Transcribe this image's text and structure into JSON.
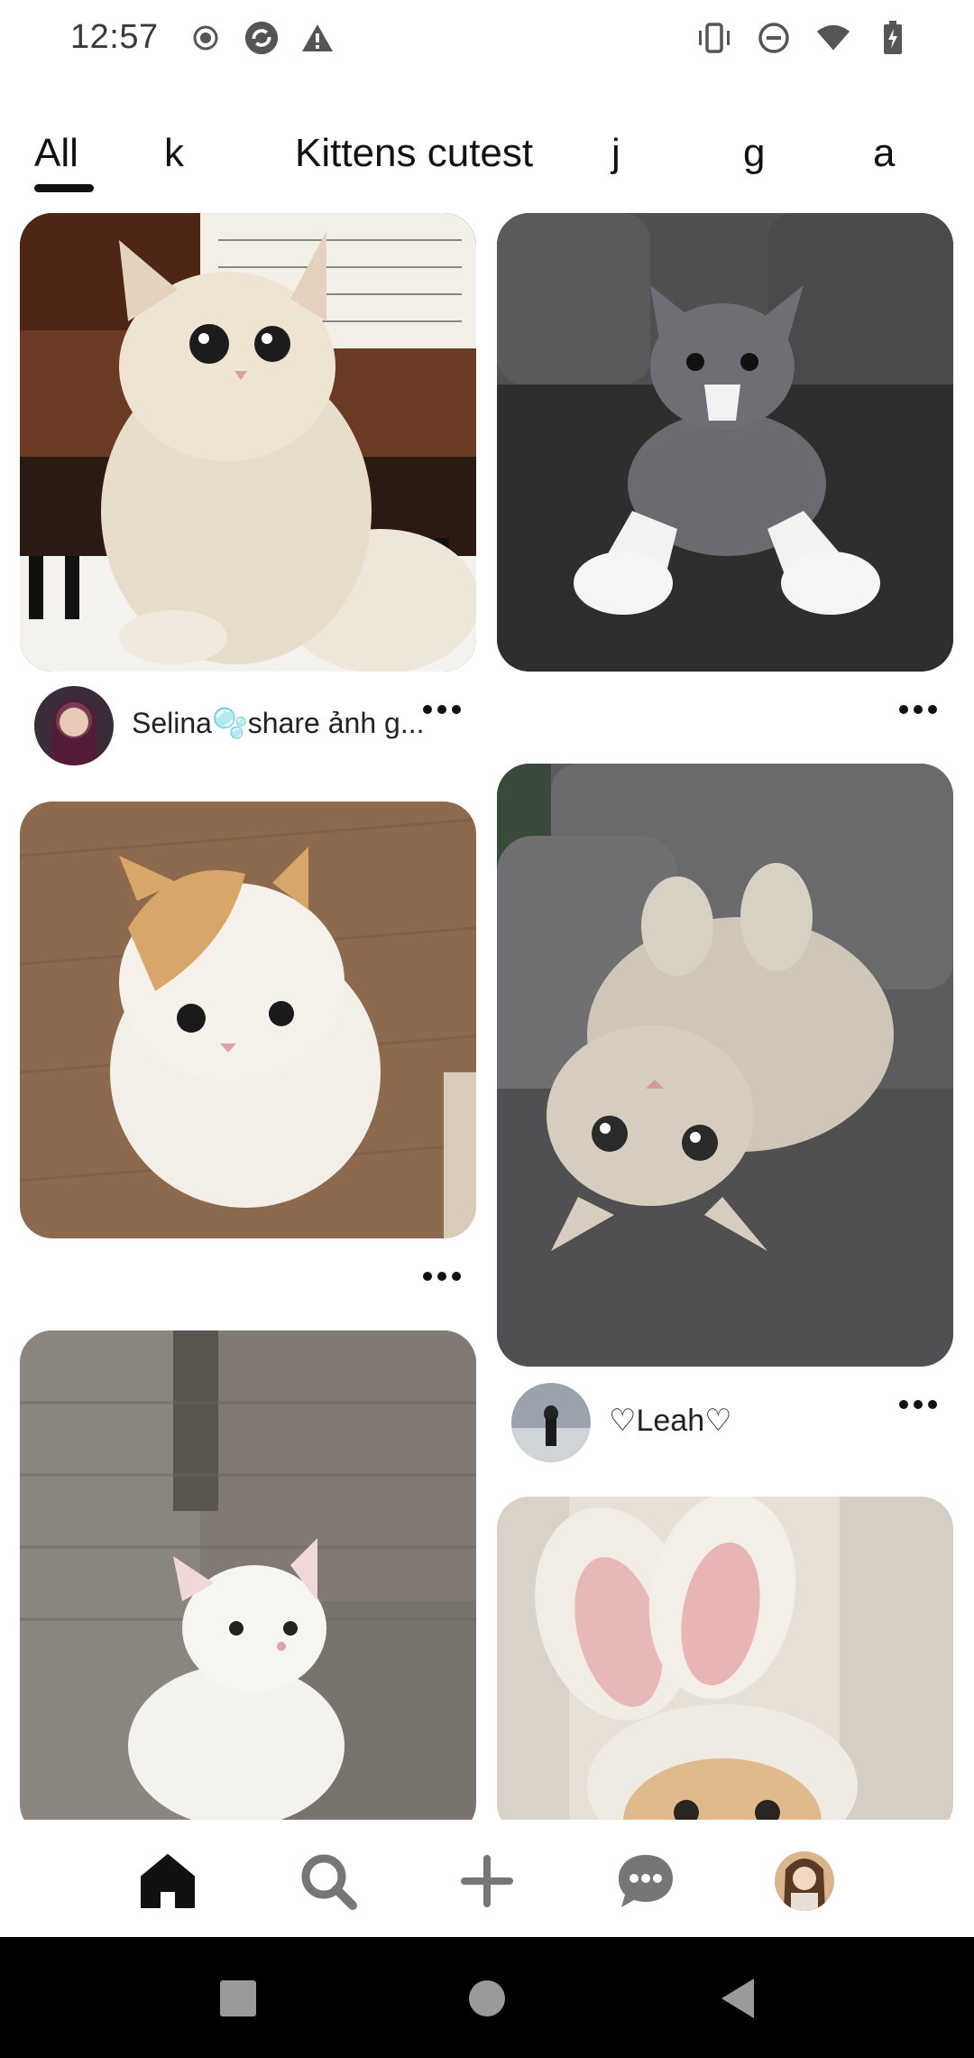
{
  "status_bar": {
    "time": "12:57",
    "left_icons": [
      "record-icon",
      "sync-icon",
      "warning-icon"
    ],
    "right_icons": [
      "vibrate-icon",
      "do-not-disturb-icon",
      "wifi-icon",
      "battery-icon"
    ]
  },
  "tabs": [
    {
      "label": "All",
      "selected": true
    },
    {
      "label": "k"
    },
    {
      "label": "Kittens cutest"
    },
    {
      "label": "j"
    },
    {
      "label": "g"
    },
    {
      "label": "a"
    }
  ],
  "pins": [
    {
      "subject": "cream kitten on piano",
      "author": "Selina🫧share ảnh g..."
    },
    {
      "subject": "grey and white kitten stretching"
    },
    {
      "subject": "cream and white kitten on wood floor"
    },
    {
      "subject": "fluffy kitten lying upside down on sofa",
      "author": "♡Leah♡"
    },
    {
      "subject": "white kitten on grey blanket"
    },
    {
      "subject": "kitten wearing bunny ears hat"
    }
  ],
  "bottom_nav": [
    "home-icon",
    "search-icon",
    "create-icon",
    "messages-icon",
    "profile-avatar"
  ],
  "colors": {
    "accent": "#111111",
    "nav_icon": "#767676"
  }
}
